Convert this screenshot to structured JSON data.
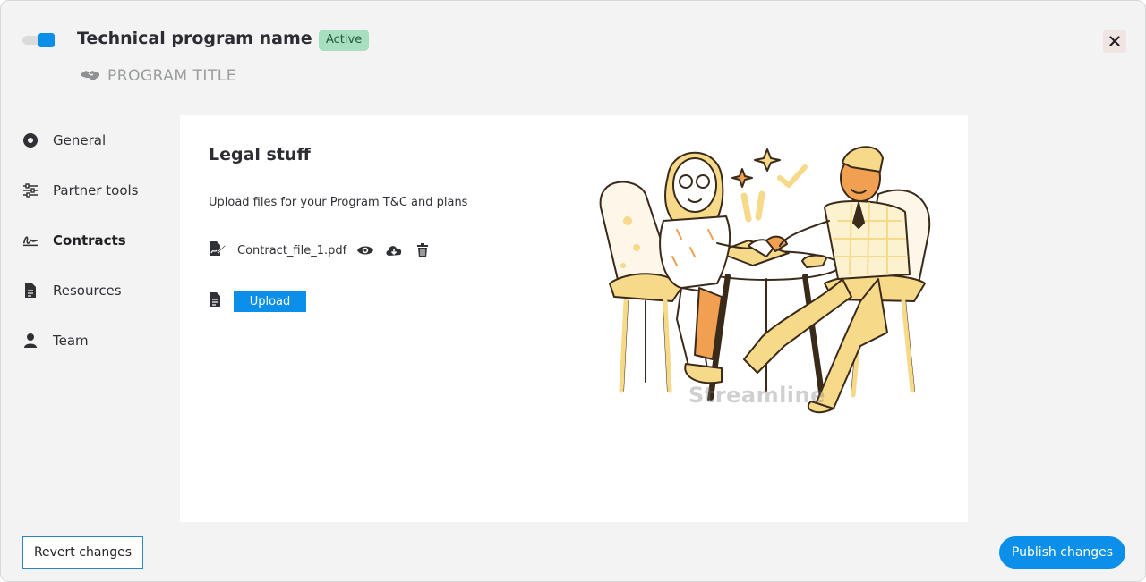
{
  "header": {
    "title": "Technical program name",
    "status_badge": "Active",
    "program_logo_text": "PROGRAM TITLE",
    "toggle_state": "on"
  },
  "sidebar": {
    "items": [
      {
        "label": "General",
        "icon": "radio-dot-icon",
        "active": false
      },
      {
        "label": "Partner tools",
        "icon": "sliders-icon",
        "active": false
      },
      {
        "label": "Contracts",
        "icon": "signature-icon",
        "active": true
      },
      {
        "label": "Resources",
        "icon": "document-icon",
        "active": false
      },
      {
        "label": "Team",
        "icon": "person-icon",
        "active": false
      }
    ]
  },
  "main": {
    "section_title": "Legal stuff",
    "description": "Upload files for your Program T&C and plans",
    "files": [
      {
        "name": "Contract_file_1.pdf"
      }
    ],
    "upload_label": "Upload",
    "illustration_watermark": "Streamline"
  },
  "footer": {
    "revert_label": "Revert changes",
    "publish_label": "Publish changes"
  },
  "colors": {
    "accent": "#0b8fe8",
    "badge_bg": "#a7dfc0",
    "badge_text": "#245b3d",
    "background": "#f2f3f2",
    "illustration_yellow": "#f7d98a"
  }
}
